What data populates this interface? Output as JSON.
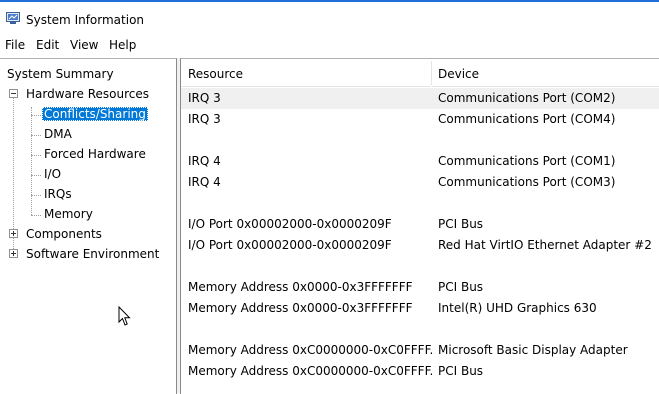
{
  "window": {
    "title": "System Information"
  },
  "menu": [
    "File",
    "Edit",
    "View",
    "Help"
  ],
  "tree": {
    "root": "System Summary",
    "hardware": {
      "label": "Hardware Resources",
      "children": [
        "Conflicts/Sharing",
        "DMA",
        "Forced Hardware",
        "I/O",
        "IRQs",
        "Memory"
      ],
      "selected": "Conflicts/Sharing"
    },
    "components": "Components",
    "software": "Software Environment"
  },
  "list": {
    "columns": [
      "Resource",
      "Device"
    ],
    "rows": [
      {
        "resource": "IRQ 3",
        "device": "Communications Port (COM2)"
      },
      {
        "resource": "IRQ 3",
        "device": "Communications Port (COM4)"
      },
      {
        "resource": "",
        "device": ""
      },
      {
        "resource": "IRQ 4",
        "device": "Communications Port (COM1)"
      },
      {
        "resource": "IRQ 4",
        "device": "Communications Port (COM3)"
      },
      {
        "resource": "",
        "device": ""
      },
      {
        "resource": "I/O Port 0x00002000-0x0000209F",
        "device": "PCI Bus"
      },
      {
        "resource": "I/O Port 0x00002000-0x0000209F",
        "device": "Red Hat VirtIO Ethernet Adapter #2"
      },
      {
        "resource": "",
        "device": ""
      },
      {
        "resource": "Memory Address 0x0000-0x3FFFFFFF",
        "device": "PCI Bus"
      },
      {
        "resource": "Memory Address 0x0000-0x3FFFFFFF",
        "device": "Intel(R) UHD Graphics 630"
      },
      {
        "resource": "",
        "device": ""
      },
      {
        "resource": "Memory Address 0xC0000000-0xC0FFFF...",
        "device": "Microsoft Basic Display Adapter"
      },
      {
        "resource": "Memory Address 0xC0000000-0xC0FFFF...",
        "device": "PCI Bus"
      }
    ]
  },
  "colors": {
    "selection": "#0078d7",
    "title_accent": "#1f6fd6"
  },
  "icons": [
    "system-information-icon",
    "mouse-pointer-icon"
  ]
}
